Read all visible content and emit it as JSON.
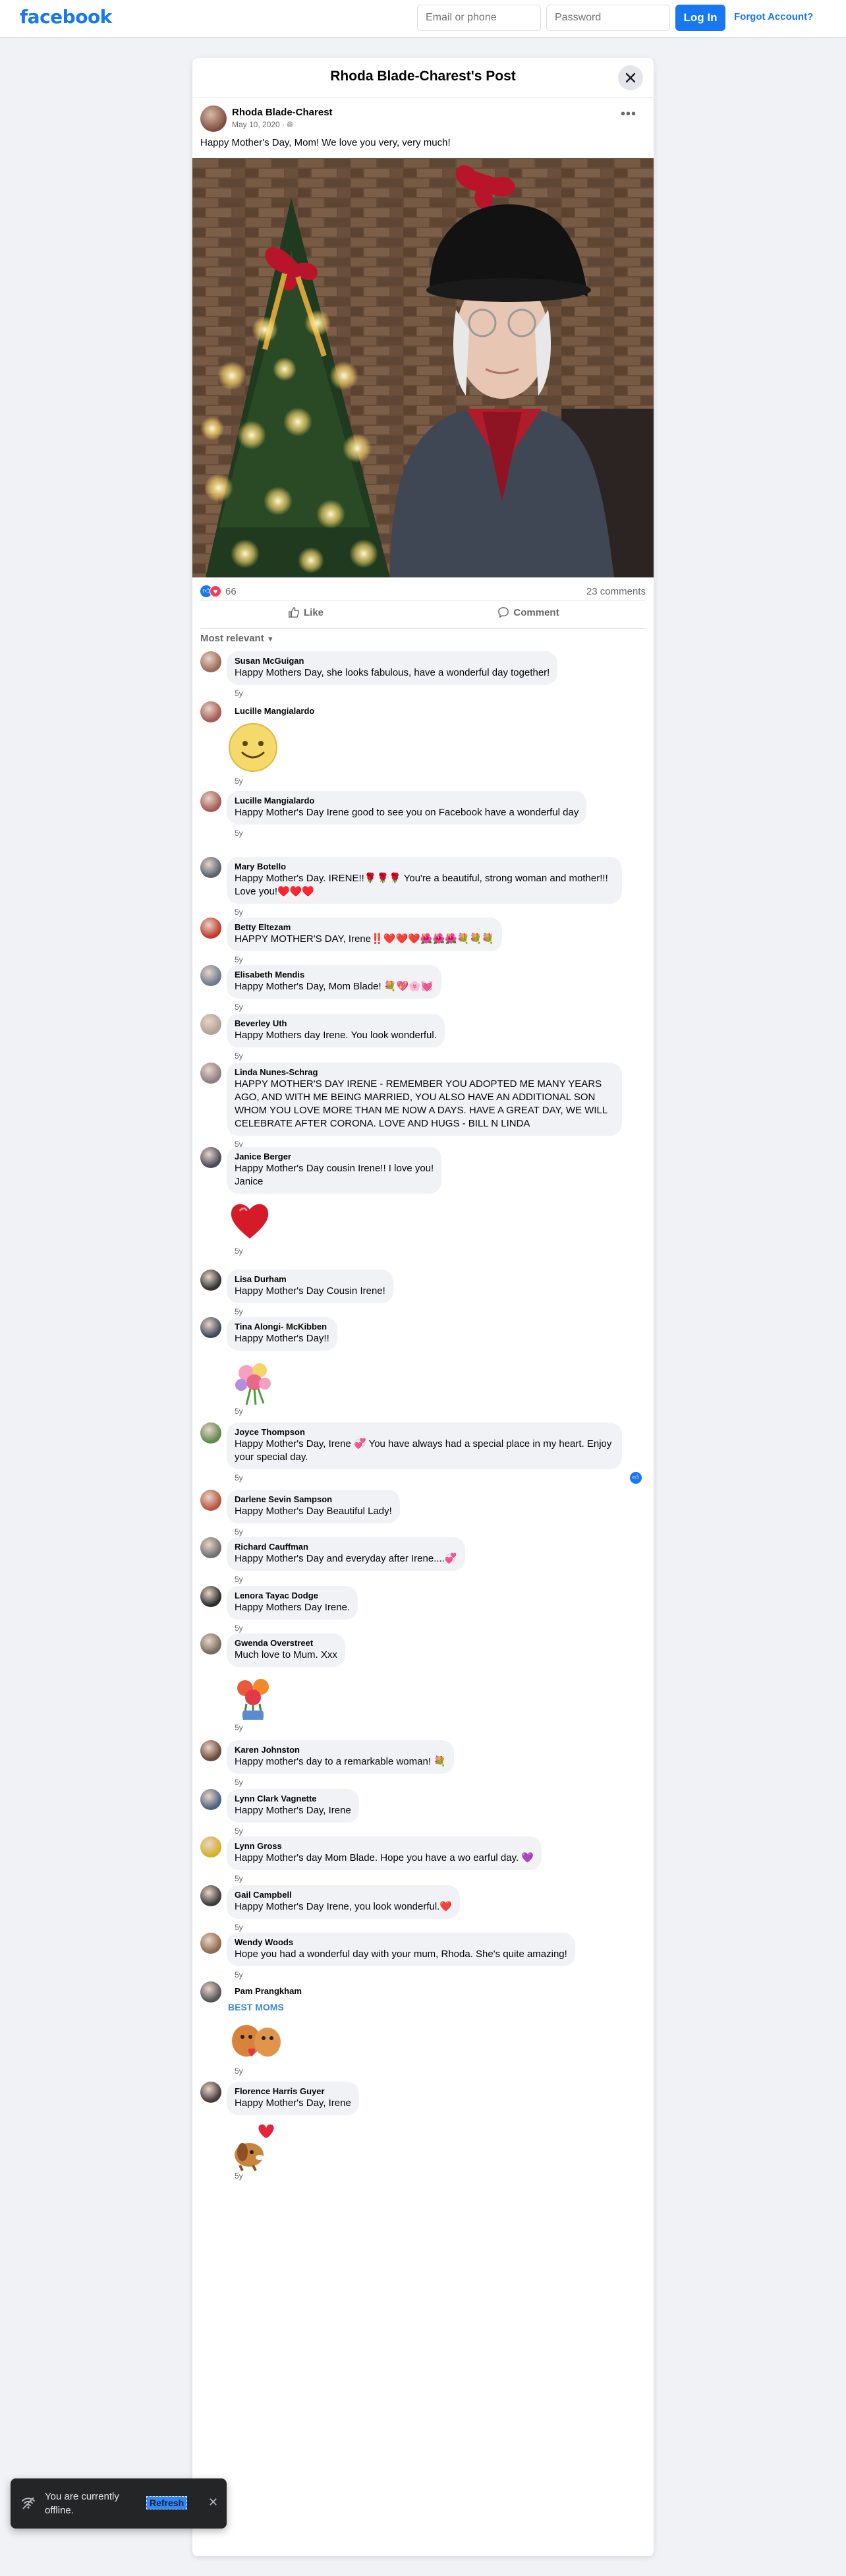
{
  "topbar": {
    "logo": "facebook",
    "email_placeholder": "Email or phone",
    "password_placeholder": "Password",
    "login_label": "Log In",
    "forgot_label": "Forgot Account?"
  },
  "post": {
    "dialog_title": "Rhoda Blade-Charest's Post",
    "author": "Rhoda Blade-Charest",
    "date": "May 10, 2020",
    "privacy_icon": "globe-icon",
    "text": "Happy Mother's Day, Mom!  We love you very, very much!",
    "reaction_count": "66",
    "comment_count": "23 comments",
    "like_label": "Like",
    "comment_label": "Comment",
    "sort_label": "Most relevant"
  },
  "comments": [
    {
      "name": "Susan McGuigan",
      "text": "Happy Mothers Day, she looks fabulous, have a wonderful day together!",
      "time": "5y",
      "color": "#9a6b5a"
    },
    {
      "name": "Lucille Mangialardo",
      "text": "",
      "time": "5y",
      "color": "#a65a55",
      "sticker": "smiley-sticker"
    },
    {
      "name": "Lucille Mangialardo",
      "text": "Happy Mother's Day Irene good to see you on Facebook have a wonderful day",
      "time": "5y",
      "color": "#a65a55"
    },
    {
      "name": "Mary Botello",
      "text": "Happy Mother's Day. IRENE!!🌹🌹🌹 You're a beautiful, strong woman and mother!!! Love you!♥️♥️♥️",
      "time": "5y",
      "color": "#556270"
    },
    {
      "name": "Betty Eltezam",
      "text": "HAPPY MOTHER'S DAY, Irene‼️❤️❤️❤️🌺🌺🌺💐💐💐",
      "time": "5y",
      "color": "#c0392b"
    },
    {
      "name": "Elisabeth Mendis",
      "text": "Happy Mother's Day, Mom Blade! 💐💖🌸💓",
      "time": "5y",
      "color": "#6b7a8f"
    },
    {
      "name": "Beverley Uth",
      "text": "Happy Mothers day Irene. You look wonderful.",
      "time": "5y",
      "color": "#b3a29a"
    },
    {
      "name": "Linda Nunes-Schrag",
      "text": "HAPPY MOTHER'S DAY IRENE - REMEMBER YOU ADOPTED ME MANY YEARS AGO, AND WITH ME BEING MARRIED, YOU ALSO HAVE AN ADDITIONAL SON WHOM YOU LOVE MORE THAN ME NOW A DAYS. HAVE A GREAT DAY, WE WILL CELEBRATE AFTER CORONA. LOVE AND HUGS - BILL N LINDA",
      "time": "5y",
      "color": "#8e7d86"
    },
    {
      "name": "Janice Berger",
      "text": "Happy Mother's Day cousin Irene!! I love you!\nJanice",
      "time": "5y",
      "color": "#4a4a5a",
      "sticker": "heart-sticker"
    },
    {
      "name": "Lisa Durham",
      "text": "Happy Mother's Day Cousin Irene!",
      "time": "5y",
      "color": "#333333"
    },
    {
      "name": "Tina Alongi- McKibben",
      "text": "Happy Mother's Day!!",
      "time": "5y",
      "color": "#3e4a5c",
      "sticker": "bouquet-sticker"
    },
    {
      "name": "Joyce Thompson",
      "text": "Happy Mother's Day, Irene 💞 You have always had a special place in my heart. Enjoy your special day.",
      "time": "5y",
      "color": "#5f8a4e",
      "liked": true
    },
    {
      "name": "Darlene Sevin Sampson",
      "text": "Happy Mother's Day Beautiful Lady!",
      "time": "5y",
      "color": "#b5563f"
    },
    {
      "name": "Richard Cauffman",
      "text": "Happy Mother's Day and everyday after Irene....💞",
      "time": "5y",
      "color": "#6f6f6f"
    },
    {
      "name": "Lenora Tayac Dodge",
      "text": "Happy Mothers Day Irene.",
      "time": "5y",
      "color": "#2b2b2b"
    },
    {
      "name": "Gwenda Overstreet",
      "text": "Much love to Mum. Xxx",
      "time": "5y",
      "color": "#7a6a5d",
      "sticker": "flowers-sticker"
    },
    {
      "name": "Karen Johnston",
      "text": "Happy mother's day to a remarkable woman! 💐",
      "time": "5y",
      "color": "#6a4a3a"
    },
    {
      "name": "Lynn Clark Vagnette",
      "text": "Happy Mother's Day, Irene",
      "time": "5y",
      "color": "#4d6280"
    },
    {
      "name": "Lynn Gross",
      "text": "Happy Mother's day Mom Blade. Hope you have a wo earful day. 💜",
      "time": "5y",
      "color": "#d4b12a"
    },
    {
      "name": "Gail Campbell",
      "text": "Happy Mother's Day Irene, you look wonderful.❤️",
      "time": "5y",
      "color": "#3a3a3a"
    },
    {
      "name": "Wendy Woods",
      "text": "Hope you had a wonderful day with your mum, Rhoda. She's quite amazing!",
      "time": "5y",
      "color": "#8d6b4a"
    },
    {
      "name": "Pam Prangkham",
      "text": "",
      "time": "5y",
      "color": "#555555",
      "sticker": "best-moms-sticker",
      "sticker_text": "BEST MOMS"
    },
    {
      "name": "Florence Harris Guyer",
      "text": "Happy Mother's Day, Irene",
      "time": "5y",
      "color": "#4a3a3a",
      "sticker": "dog-heart-sticker"
    }
  ],
  "toast": {
    "text": "You are currently offline.",
    "refresh_label": "Refresh",
    "icon": "offline-wifi-icon"
  }
}
